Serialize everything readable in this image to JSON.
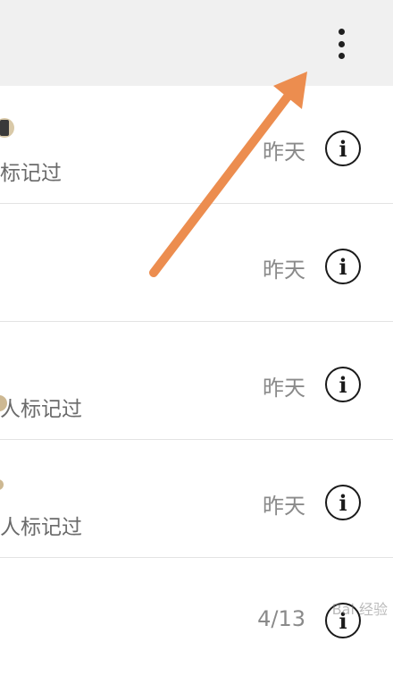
{
  "header": {
    "more_icon": "more-vertical-icon"
  },
  "rows": [
    {
      "subtitle": "标记过",
      "time": "昨天",
      "info_icon": "i"
    },
    {
      "subtitle": "",
      "time": "昨天",
      "info_icon": "i"
    },
    {
      "subtitle": "人标记过",
      "time": "昨天",
      "info_icon": "i"
    },
    {
      "subtitle": "人标记过",
      "time": "昨天",
      "info_icon": "i"
    },
    {
      "subtitle": "",
      "time": "4/13",
      "info_icon": "i"
    }
  ],
  "annotation": {
    "arrow_color": "#ec8d4f"
  },
  "watermark": "Bai 经验"
}
